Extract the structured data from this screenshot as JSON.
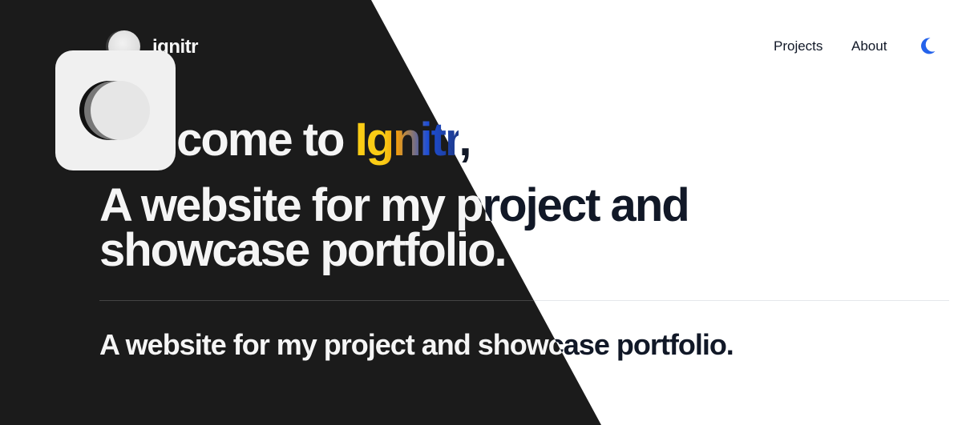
{
  "brand": {
    "name": "ignitr"
  },
  "nav": {
    "projects_label": "Projects",
    "about_label": "About"
  },
  "hero": {
    "welcome_prefix": "Welcome to ",
    "welcome_brand": "Ignitr",
    "welcome_suffix": ",",
    "line2": "A website for my project and",
    "line3": "showcase portfolio.",
    "subheading": "A website for my project and showcase portfolio."
  },
  "colors": {
    "dark_bg": "#1b1b1b",
    "light_bg": "#ffffff",
    "brand_gradient_start": "#facc15",
    "brand_gradient_end": "#1e3a8a",
    "moon_icon": "#2563eb"
  },
  "icons": {
    "logo": "logo-disc-icon",
    "theme_toggle": "moon-icon",
    "theme_badge": "theme-toggle-icon"
  }
}
